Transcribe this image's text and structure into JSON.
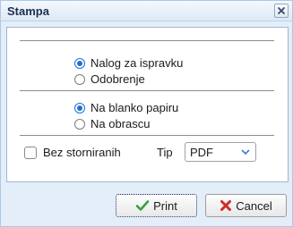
{
  "window": {
    "title": "Stampa",
    "close_icon": "close-icon"
  },
  "report_type": {
    "options": [
      {
        "label": "Nalog za ispravku",
        "selected": true
      },
      {
        "label": "Odobrenje",
        "selected": false
      }
    ]
  },
  "paper_type": {
    "options": [
      {
        "label": "Na blanko papiru",
        "selected": true
      },
      {
        "label": "Na obrascu",
        "selected": false
      }
    ]
  },
  "options": {
    "no_cancelled_label": "Bez storniranih",
    "no_cancelled_checked": false,
    "type_label": "Tip",
    "type_value": "PDF"
  },
  "buttons": {
    "print_label": "Print",
    "print_icon": "checkmark-icon",
    "cancel_label": "Cancel",
    "cancel_icon": "red-x-icon"
  },
  "colors": {
    "accent": "#1f6fd3",
    "dialog_bg": "#e4eef8",
    "title_text": "#1a2f52"
  }
}
